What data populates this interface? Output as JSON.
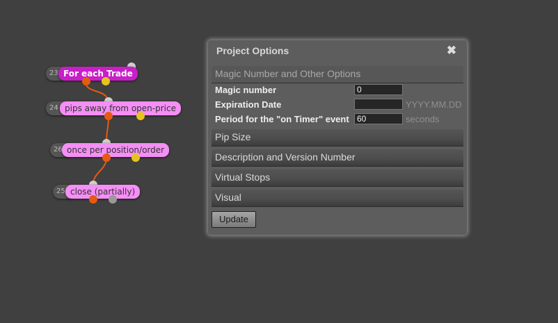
{
  "blocks": [
    {
      "number": "23",
      "label": "For each Trade"
    },
    {
      "number": "24",
      "label": "pips away from open-price"
    },
    {
      "number": "26",
      "label": "once per position/order"
    },
    {
      "number": "25",
      "label": "close (partially)"
    }
  ],
  "panel": {
    "title": "Project Options",
    "close_icon": "close-icon",
    "sections": [
      "Magic Number and Other Options",
      "Pip Size",
      "Description and Version Number",
      "Virtual Stops",
      "Visual"
    ],
    "options": [
      {
        "label": "Magic number",
        "value": "0",
        "hint": ""
      },
      {
        "label": "Expiration Date",
        "value": "",
        "hint": "YYYY.MM.DD"
      },
      {
        "label": "Period for the \"on Timer\" event",
        "value": "60",
        "hint": "seconds"
      }
    ],
    "update_label": "Update"
  },
  "colors": {
    "background": "#404040",
    "main_block": "#c81fc8",
    "sub_block": "#f58ef5",
    "connector": "#e65b10",
    "output_yellow": "#e6c41c"
  }
}
